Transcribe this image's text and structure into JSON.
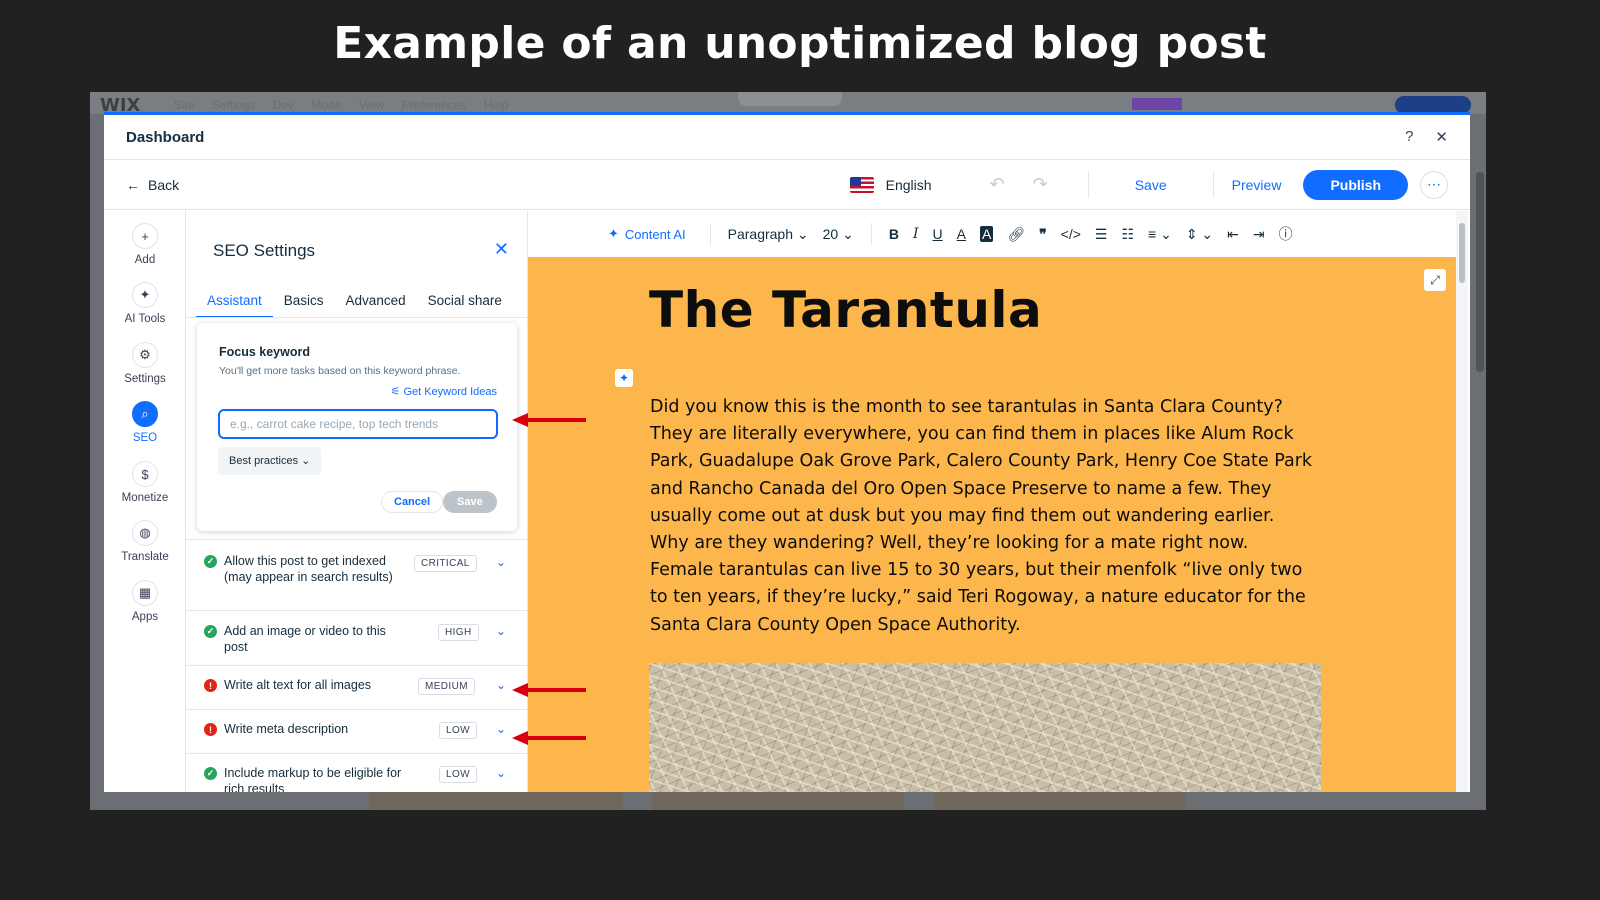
{
  "slide": {
    "title": "Example of an unoptimized blog post"
  },
  "background": {
    "logo": "WIX",
    "menu": "Site Settings Dev Mode View Preferences Help"
  },
  "modal": {
    "title": "Dashboard",
    "help_icon": "question-icon",
    "close_icon": "close-icon"
  },
  "topbar": {
    "back": "Back",
    "language": "English",
    "save": "Save",
    "preview": "Preview",
    "publish": "Publish",
    "more": "⋯",
    "accent": "#116dff"
  },
  "rail": {
    "items": [
      {
        "label": "Add",
        "icon": "+"
      },
      {
        "label": "AI Tools",
        "icon": "✦"
      },
      {
        "label": "Settings",
        "icon": "⚙"
      },
      {
        "label": "SEO",
        "icon": "⌕"
      },
      {
        "label": "Monetize",
        "icon": "$"
      },
      {
        "label": "Translate",
        "icon": "◍"
      },
      {
        "label": "Apps",
        "icon": "▦"
      }
    ]
  },
  "seo": {
    "title": "SEO Settings",
    "tabs": [
      "Assistant",
      "Basics",
      "Advanced",
      "Social share"
    ],
    "focus": {
      "title": "Focus keyword",
      "hint": "You'll get more tasks based on this keyword phrase.",
      "ideas": "Get Keyword Ideas",
      "placeholder": "e.g., carrot cake recipe, top tech trends",
      "best_practices": "Best practices",
      "cancel": "Cancel",
      "save": "Save"
    },
    "tasks": [
      {
        "text": "Allow this post to get indexed (may appear in search results)",
        "priority": "CRITICAL",
        "status": "done"
      },
      {
        "text": "Add an image or video to this post",
        "priority": "HIGH",
        "status": "done"
      },
      {
        "text": "Write alt text for all images",
        "priority": "MEDIUM",
        "status": "error"
      },
      {
        "text": "Write meta description",
        "priority": "LOW",
        "status": "error"
      },
      {
        "text": "Include markup to be eligible for rich results",
        "priority": "LOW",
        "status": "done"
      }
    ],
    "status_colors": {
      "done": "#25a55f",
      "error": "#e62214"
    }
  },
  "toolbar": {
    "content_ai": "Content AI",
    "paragraph": "Paragraph",
    "font_size": "20"
  },
  "post": {
    "title": "The Tarantula",
    "body": "Did you know this is the month to see tarantulas in Santa Clara County? They are literally everywhere, you can find them in places like Alum Rock Park, Guadalupe Oak Grove Park, Calero County Park, Henry Coe State Park and Rancho Canada del Oro Open Space Preserve to name a few. They usually come out at dusk but you may find them out wandering earlier. Why are they wandering? Well, they’re looking for a mate right now.",
    "body2": "Female tarantulas can live 15 to 30 years, but their menfolk “live only two to ten years, if they’re lucky,” said Teri Rogoway, a nature educator for the Santa Clara County Open Space Authority.",
    "background_color": "#fdb64b"
  },
  "annotations": {
    "arrow_color": "#d9000d"
  }
}
